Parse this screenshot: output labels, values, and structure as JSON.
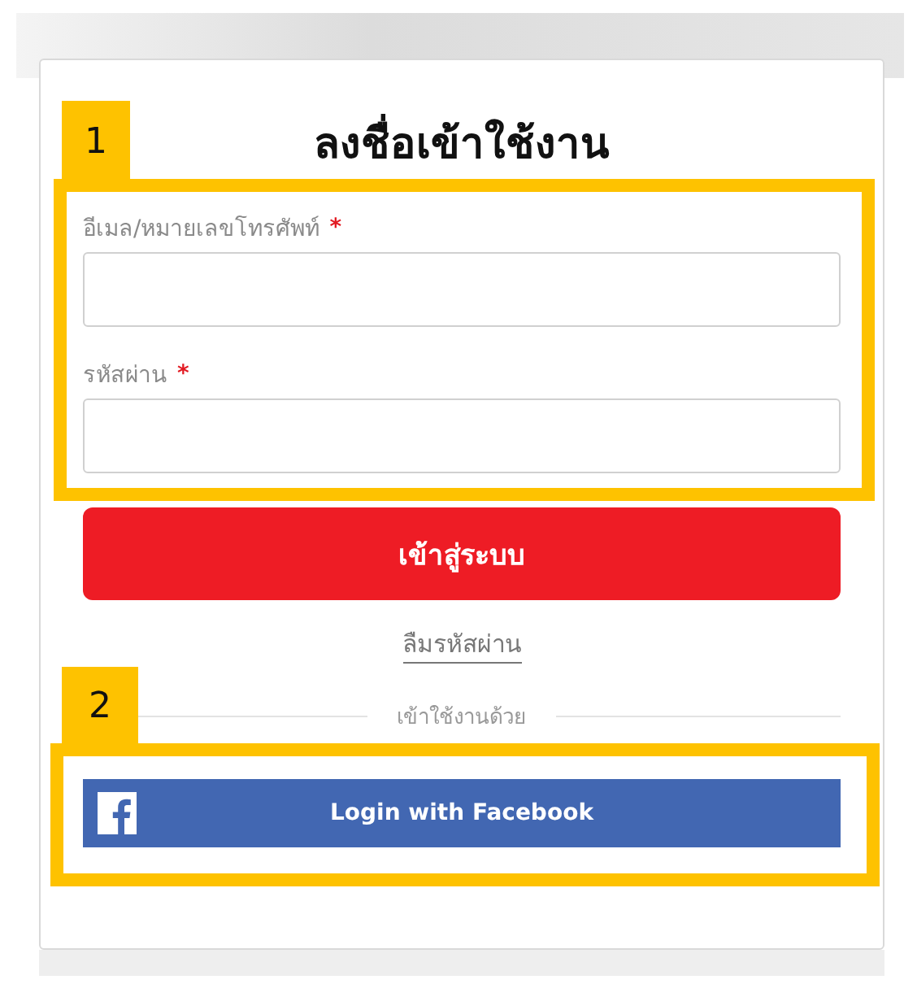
{
  "title": "ลงชื่อเข้าใช้งาน",
  "fields": [
    {
      "label": "อีเมล/หมายเลขโทรศัพท์",
      "required_mark": "*"
    },
    {
      "label": "รหัสผ่าน",
      "required_mark": "*"
    }
  ],
  "submit_button": "เข้าสู่ระบบ",
  "forgot_link": "ลืมรหัสผ่าน",
  "divider_text": "เข้าใช้งานด้วย",
  "facebook_button": "Login with Facebook",
  "annotations": [
    {
      "number": "1"
    },
    {
      "number": "2"
    }
  ]
}
